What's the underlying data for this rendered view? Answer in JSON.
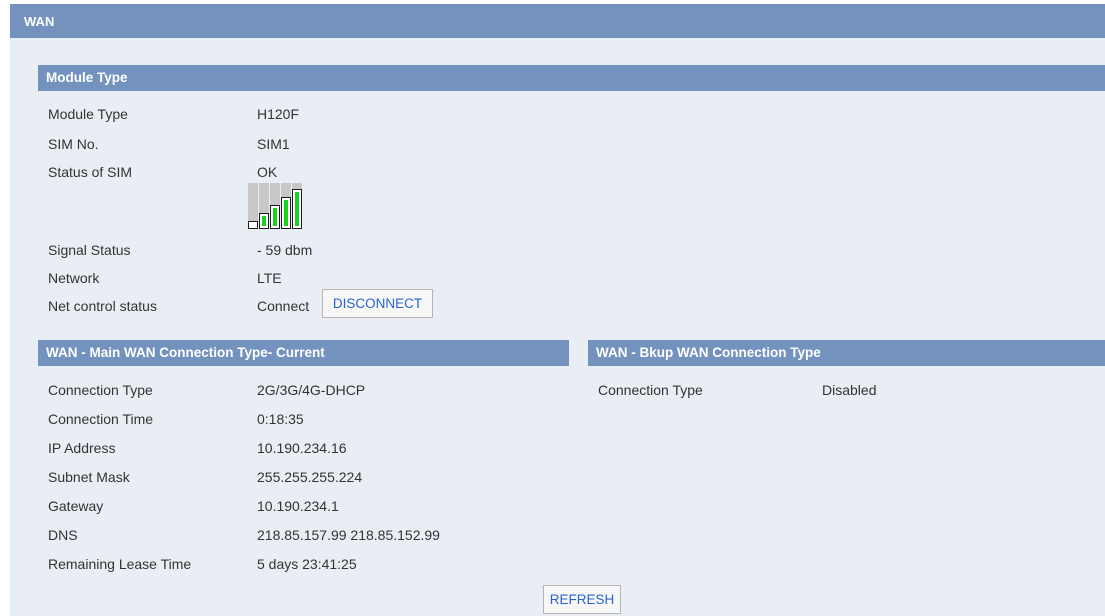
{
  "header": {
    "title": "WAN"
  },
  "module": {
    "title": "Module Type",
    "rows": [
      {
        "label": "Module Type",
        "value": "H120F"
      },
      {
        "label": "SIM No.",
        "value": "SIM1"
      },
      {
        "label": "Status of SIM",
        "value": "OK"
      }
    ],
    "signal": {
      "bars_total": 5,
      "bars_lit": 4,
      "lit_color": "#19d11f",
      "unlit_color": "#c8c8c8",
      "label": "Signal Status",
      "value": "- 59 dbm"
    },
    "network": {
      "label": "Network",
      "value": "LTE"
    },
    "net_control": {
      "label": "Net control status",
      "value": "Connect",
      "button": "DISCONNECT"
    }
  },
  "main_wan": {
    "title": "WAN - Main WAN Connection Type- Current",
    "rows": [
      {
        "label": "Connection Type",
        "value": "2G/3G/4G-DHCP"
      },
      {
        "label": "Connection Time",
        "value": "0:18:35"
      },
      {
        "label": "IP Address",
        "value": "10.190.234.16"
      },
      {
        "label": "Subnet Mask",
        "value": "255.255.255.224"
      },
      {
        "label": "Gateway",
        "value": "10.190.234.1"
      },
      {
        "label": "DNS",
        "value": "218.85.157.99 218.85.152.99"
      },
      {
        "label": "Remaining Lease Time",
        "value": "5 days 23:41:25"
      }
    ]
  },
  "bkup_wan": {
    "title": "WAN - Bkup WAN Connection Type",
    "rows": [
      {
        "label": "Connection Type",
        "value": "Disabled"
      }
    ]
  },
  "footer": {
    "refresh_label": "REFRESH"
  },
  "colors": {
    "header_bg": "#7393be",
    "panel_bg": "#e9eef5",
    "button_text": "#2a64c8"
  }
}
